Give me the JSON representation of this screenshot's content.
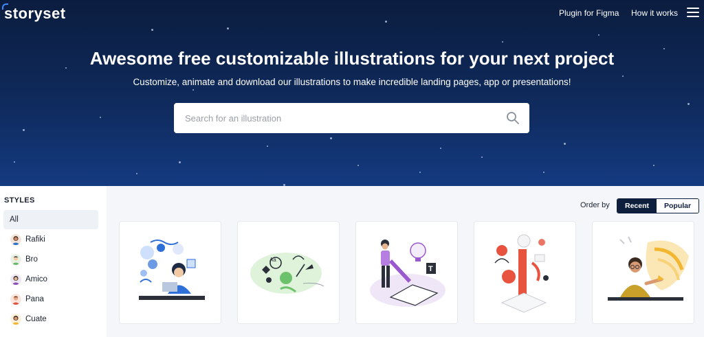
{
  "header": {
    "logo_text": "storyset",
    "nav": {
      "plugin_label": "Plugin for Figma",
      "how_label": "How it works"
    },
    "menu_icon": "hamburger-icon"
  },
  "hero": {
    "title": "Awesome free customizable illustrations for your next project",
    "subtitle": "Customize, animate and download our illustrations to make incredible landing pages, app or presentations!",
    "search": {
      "placeholder": "Search for an illustration",
      "value": "",
      "icon": "search-icon"
    }
  },
  "sidebar": {
    "title": "STYLES",
    "items": [
      {
        "label": "All",
        "active": true
      },
      {
        "label": "Rafiki",
        "active": false
      },
      {
        "label": "Bro",
        "active": false
      },
      {
        "label": "Amico",
        "active": false
      },
      {
        "label": "Pana",
        "active": false
      },
      {
        "label": "Cuate",
        "active": false
      }
    ]
  },
  "toolbar": {
    "order_label": "Order by",
    "options": [
      "Recent",
      "Popular"
    ],
    "selected": "Recent"
  },
  "cards": [
    {
      "name": "woman-at-desk-illustration",
      "accent": "#2f6fd8"
    },
    {
      "name": "creative-doodles-illustration",
      "accent": "#6cc16c"
    },
    {
      "name": "woman-with-pencil-illustration",
      "accent": "#9b59d0"
    },
    {
      "name": "design-tools-illustration",
      "accent": "#e8533f"
    },
    {
      "name": "man-with-idea-illustration",
      "accent": "#f2b631"
    }
  ],
  "colors": {
    "hero_top": "#0b1d3f",
    "hero_bottom": "#143a80",
    "logo_accent": "#3f8bff",
    "button_dark": "#0e1f3d",
    "main_bg": "#f4f6f9"
  }
}
